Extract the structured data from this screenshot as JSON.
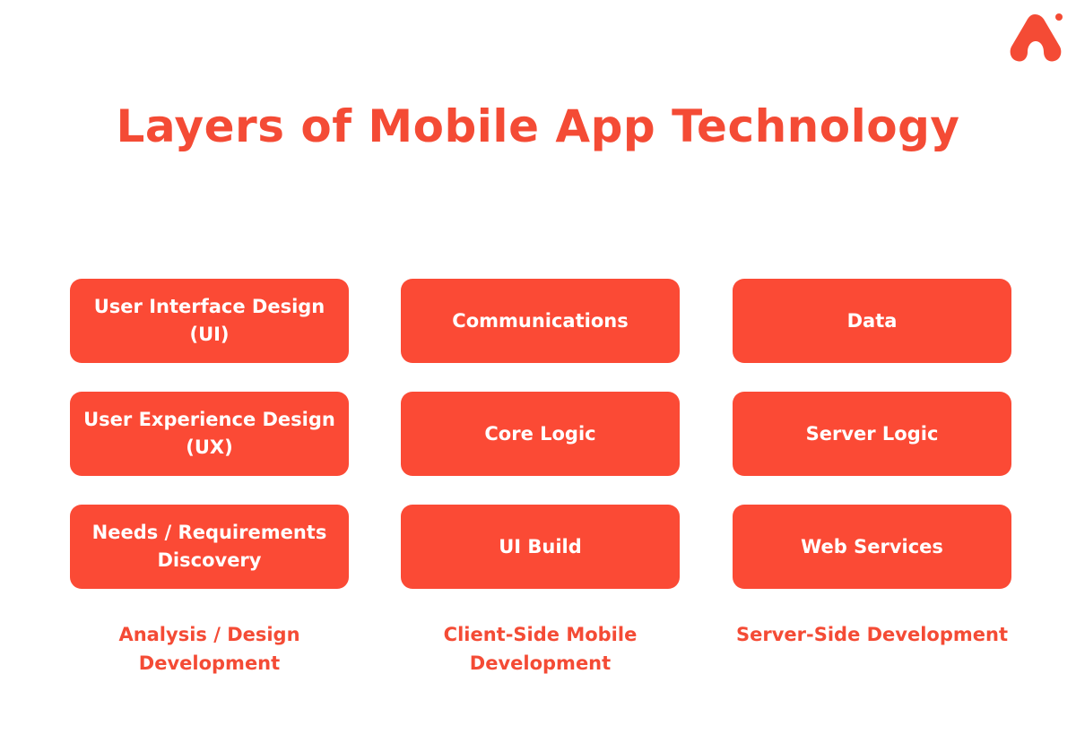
{
  "header": {
    "title": "Layers of Mobile App Technology",
    "logo_icon": "brand-a-logo-icon"
  },
  "colors": {
    "accent": "#fb4a35",
    "title": "#f44b35",
    "box_text": "#ffffff",
    "background": "#ffffff"
  },
  "columns": [
    {
      "label": "Analysis / Design Development",
      "items": [
        "User Interface Design (UI)",
        "User Experience Design (UX)",
        "Needs / Requirements Discovery"
      ]
    },
    {
      "label": "Client-Side Mobile Development",
      "items": [
        "Communications",
        "Core Logic",
        "UI Build"
      ]
    },
    {
      "label": "Server-Side Development",
      "items": [
        "Data",
        "Server Logic",
        "Web Services"
      ]
    }
  ]
}
